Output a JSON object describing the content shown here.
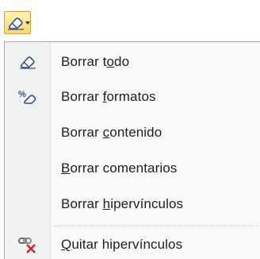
{
  "toolbar": {
    "clear_button": {
      "icon": "eraser-icon",
      "has_dropdown": true
    }
  },
  "menu": {
    "items": [
      {
        "pre": "Borrar t",
        "key": "o",
        "post": "do",
        "icon": "eraser-icon"
      },
      {
        "pre": "Borrar ",
        "key": "f",
        "post": "ormatos",
        "icon": "clear-formats-icon"
      },
      {
        "pre": "Borrar ",
        "key": "c",
        "post": "ontenido",
        "icon": ""
      },
      {
        "pre": "",
        "key": "B",
        "post": "orrar comentarios",
        "icon": ""
      },
      {
        "pre": "Borrar ",
        "key": "h",
        "post": "ipervínculos",
        "icon": ""
      },
      {
        "pre": "",
        "key": "Q",
        "post": "uitar hipervínculos",
        "icon": "remove-hyperlink-icon"
      }
    ]
  }
}
